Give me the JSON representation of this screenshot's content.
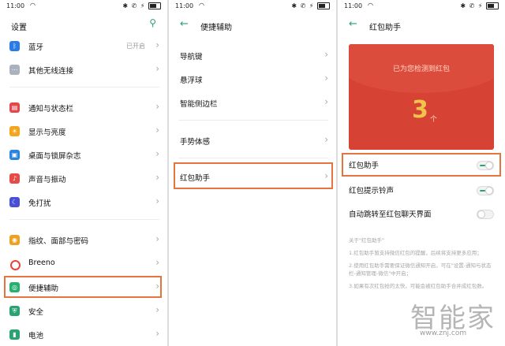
{
  "status": {
    "time": "11:00",
    "right_icons": "✱ ✆ ⚡"
  },
  "panel1": {
    "title": "设置",
    "items": [
      {
        "label": "蓝牙",
        "value": "已开启",
        "color": "#2b7be4",
        "icon": "bluetooth-icon"
      },
      {
        "label": "其他无线连接",
        "color": "#aab2bd",
        "icon": "wireless-icon"
      },
      {
        "label": "通知与状态栏",
        "color": "#e4464b",
        "icon": "notification-icon"
      },
      {
        "label": "显示与亮度",
        "color": "#f4a51c",
        "icon": "brightness-icon"
      },
      {
        "label": "桌面与锁屏杂志",
        "color": "#2a84e0",
        "icon": "desktop-icon"
      },
      {
        "label": "声音与振动",
        "color": "#e84b45",
        "icon": "sound-icon"
      },
      {
        "label": "免打扰",
        "color": "#4a4fd8",
        "icon": "moon-icon"
      },
      {
        "label": "指纹、面部与密码",
        "color": "#f0a020",
        "icon": "fingerprint-icon"
      },
      {
        "label": "Breeno",
        "color": "#e8443a",
        "icon": "breeno-icon"
      },
      {
        "label": "便捷辅助",
        "color": "#26b06e",
        "icon": "accessibility-icon"
      },
      {
        "label": "安全",
        "color": "#2aa372",
        "icon": "shield-icon"
      },
      {
        "label": "电池",
        "color": "#2aa372",
        "icon": "battery-icon"
      }
    ]
  },
  "panel2": {
    "title": "便捷辅助",
    "items": [
      {
        "label": "导航键"
      },
      {
        "label": "悬浮球"
      },
      {
        "label": "智能侧边栏"
      },
      {
        "label": "手势体感"
      },
      {
        "label": "红包助手"
      }
    ]
  },
  "panel3": {
    "title": "红包助手",
    "card": {
      "message": "已为您检测到红包",
      "count": "3",
      "unit": "个"
    },
    "settings": [
      {
        "label": "红包助手",
        "state": "on"
      },
      {
        "label": "红包提示铃声",
        "state": "on"
      },
      {
        "label": "自动跳转至红包聊天界面",
        "state": "off"
      }
    ],
    "about_title": "关于\"红包助手\"",
    "about_lines": [
      "1.红包助手暂支持微信红包的提醒，后续将支持更多应用；",
      "2.使用红包助手需要保证微信通知开启，可在\"设置-通知与状态栏-通知管理-微信\"中开启；",
      "3.如果有次红包抢的太快，可能会被红包助手合并成红包数。"
    ]
  },
  "watermark": {
    "text": "智能家",
    "url": "www.znj.com"
  },
  "accent": "#2aa372",
  "highlight_color": "#e5753e"
}
